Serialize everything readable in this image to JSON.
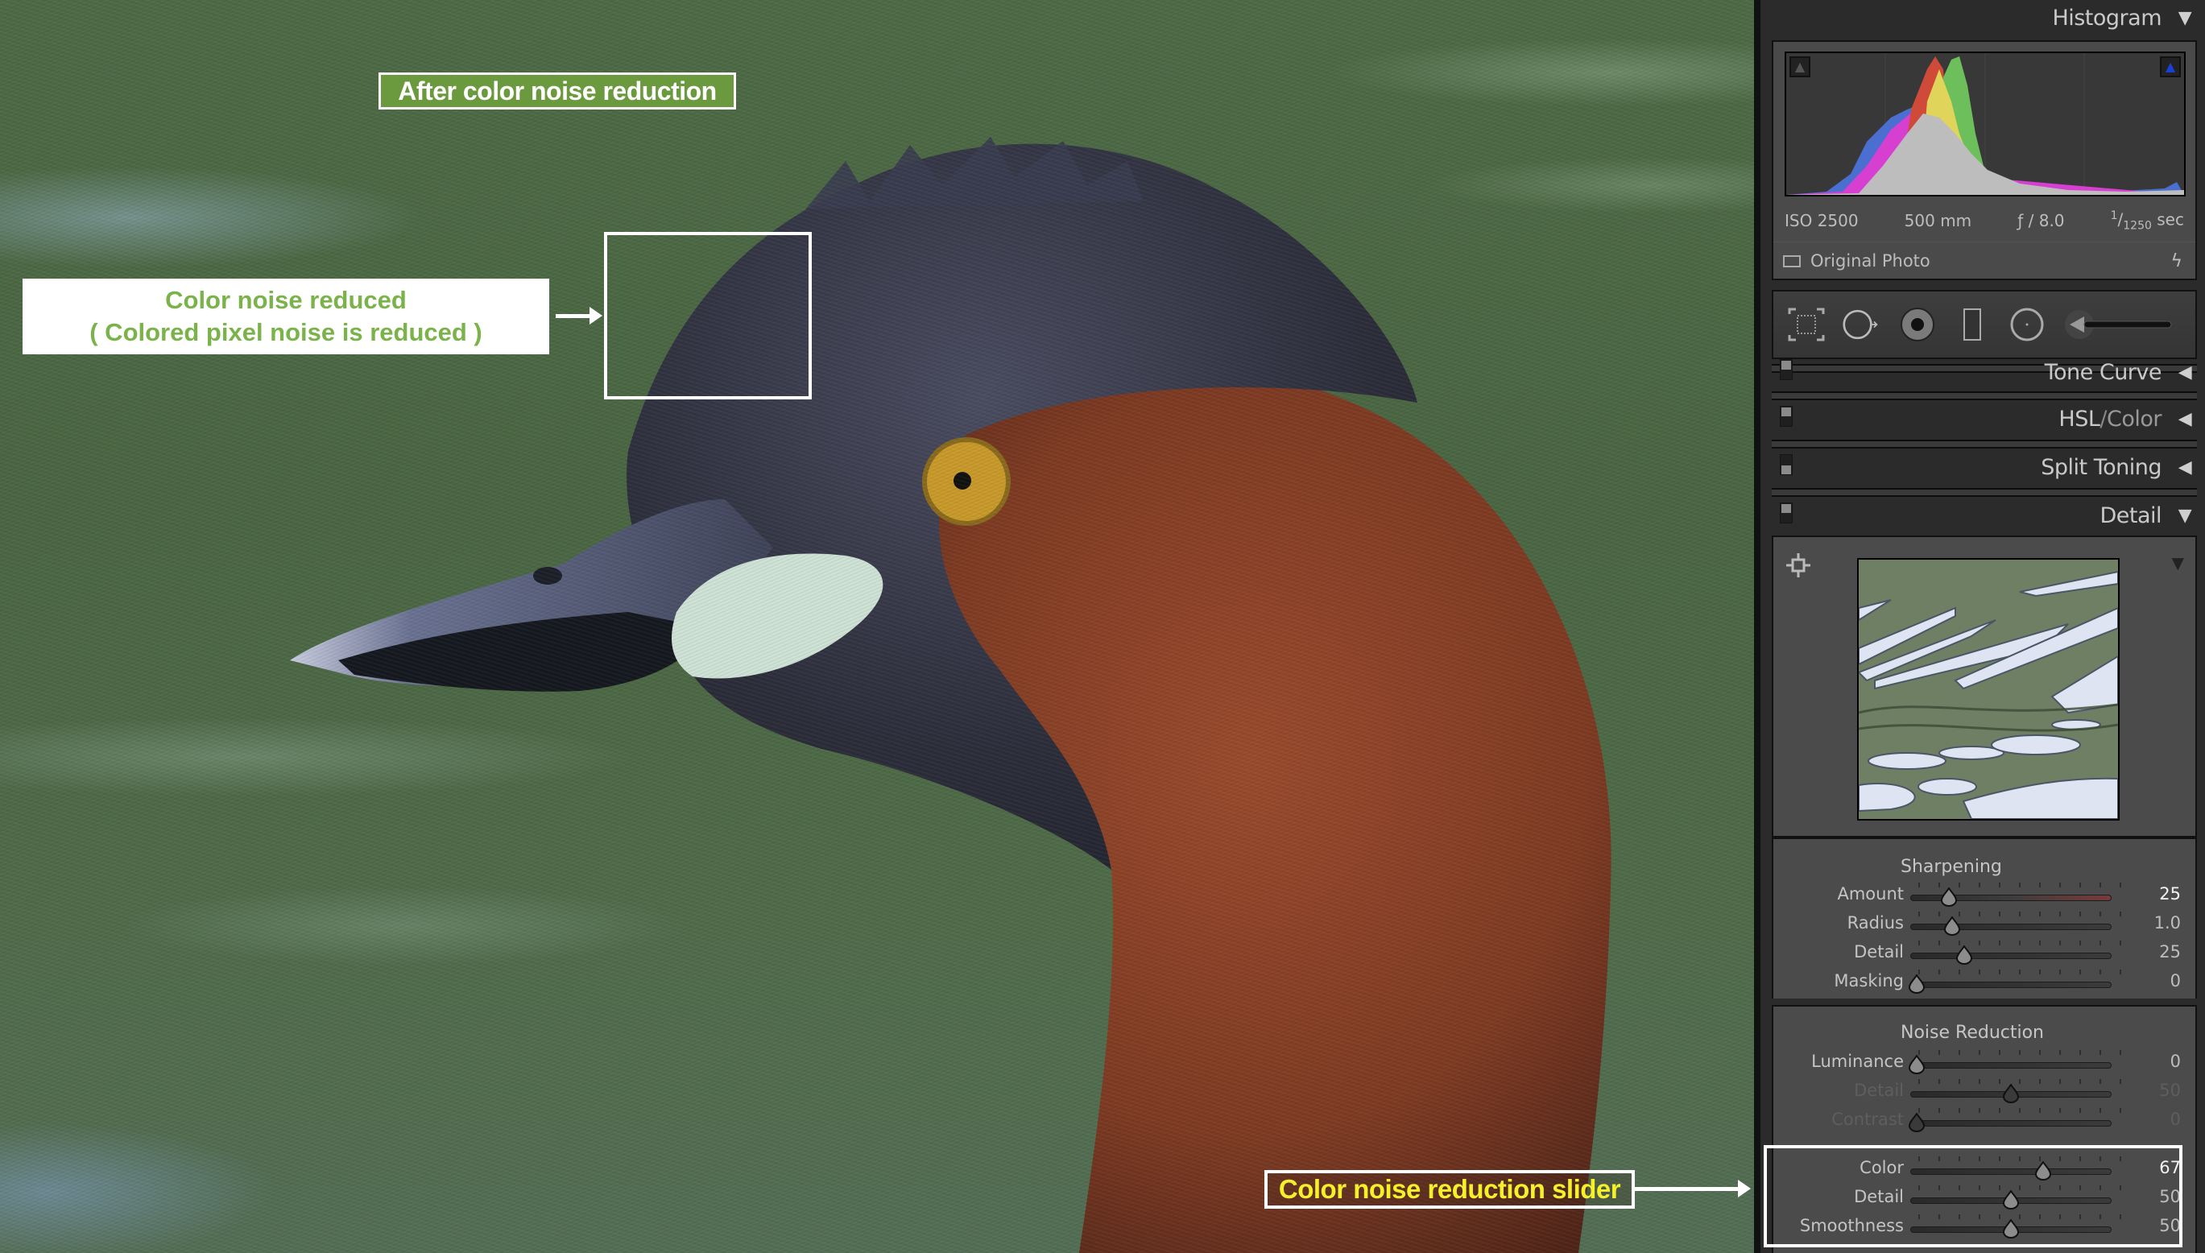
{
  "annotations": {
    "title": "After color noise reduction",
    "reduced_line1": "Color noise reduced",
    "reduced_line2": "( Colored pixel noise is reduced )",
    "slider_callout": "Color noise reduction slider"
  },
  "panel": {
    "histogram": {
      "title": "Histogram",
      "collapse_icon": "triangle-down",
      "shadow_clip_icon": "triangle-up",
      "highlight_clip_icon": "triangle-up-blue",
      "exif": {
        "iso": "ISO 2500",
        "focal_length": "500 mm",
        "aperture": "ƒ / 8.0",
        "shutter_num": "1",
        "shutter_den": "1250",
        "shutter_unit": "sec"
      },
      "original_photo_label": "Original Photo",
      "original_photo_checked": false
    },
    "tools": [
      "crop-overlay-tool",
      "spot-removal-tool",
      "red-eye-tool",
      "graduated-filter-tool",
      "radial-filter-tool",
      "adjustment-brush-tool"
    ],
    "sections": [
      {
        "title": "Tone Curve",
        "expanded": false,
        "enabled": true
      },
      {
        "title": "HSL",
        "title_sep": "/",
        "title_part2": "Color",
        "expanded": false,
        "enabled": true
      },
      {
        "title": "Split Toning",
        "expanded": false,
        "enabled": false
      },
      {
        "title": "Detail",
        "expanded": true,
        "enabled": true
      }
    ],
    "detail": {
      "sharpening": {
        "title": "Sharpening",
        "sliders": [
          {
            "label": "Amount",
            "value": "25",
            "fraction": 0.17,
            "highlight": true
          },
          {
            "label": "Radius",
            "value": "1.0",
            "fraction": 0.19
          },
          {
            "label": "Detail",
            "value": "25",
            "fraction": 0.25
          },
          {
            "label": "Masking",
            "value": "0",
            "fraction": 0.0
          }
        ]
      },
      "noise_reduction": {
        "title": "Noise Reduction",
        "sliders": [
          {
            "label": "Luminance",
            "value": "0",
            "fraction": 0.0
          },
          {
            "label": "Detail",
            "value": "50",
            "fraction": 0.5,
            "disabled": true
          },
          {
            "label": "Contrast",
            "value": "0",
            "fraction": 0.0,
            "disabled": true
          },
          {
            "label": "Color",
            "value": "67",
            "fraction": 0.67,
            "highlight": true
          },
          {
            "label": "Detail",
            "value": "50",
            "fraction": 0.5
          },
          {
            "label": "Smoothness",
            "value": "50",
            "fraction": 0.5
          }
        ]
      }
    }
  }
}
